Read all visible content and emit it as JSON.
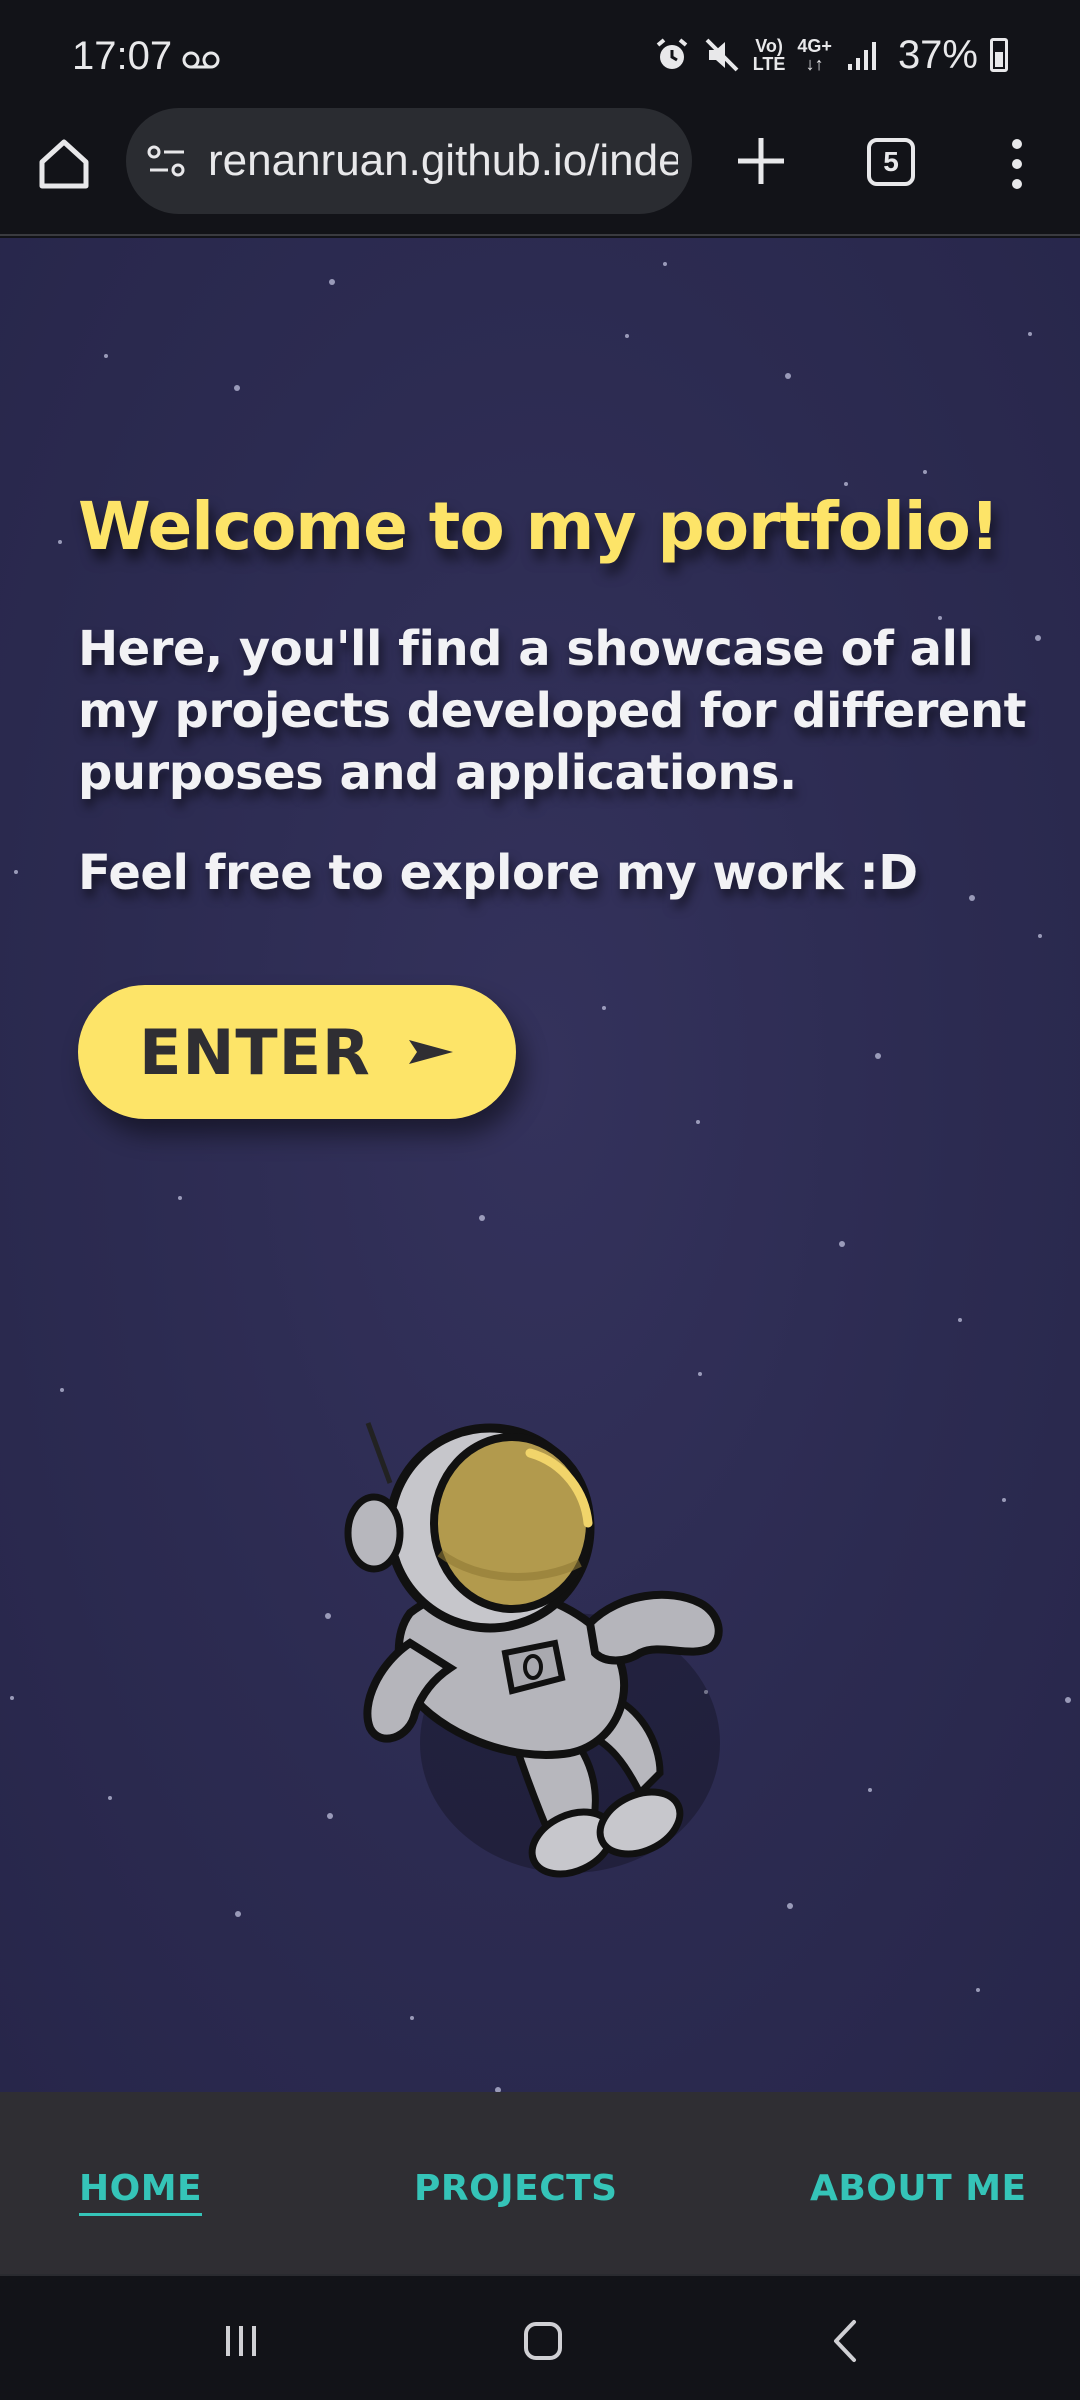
{
  "status_bar": {
    "time": "17:07",
    "battery": "37%",
    "network_top": "Vo)",
    "network_bottom": "LTE",
    "data_type": "4G+"
  },
  "browser": {
    "url": "renanruan.github.io/index",
    "tab_count": "5"
  },
  "hero": {
    "title": "Welcome to my portfolio!",
    "description": "Here, you'll find a showcase of all my projects developed for different purposes and applications.",
    "subtitle": "Feel free to explore my work :D",
    "enter_label": "ENTER"
  },
  "nav": {
    "home": "HOME",
    "projects": "PROJECTS",
    "about": "ABOUT ME"
  },
  "colors": {
    "accent_yellow": "#fde468",
    "nav_teal": "#35c4b8",
    "background": "#2c2b51"
  }
}
